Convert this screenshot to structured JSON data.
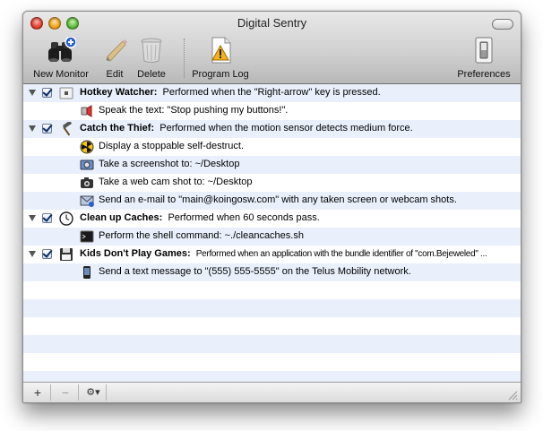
{
  "window": {
    "title": "Digital Sentry"
  },
  "toolbar": {
    "new_monitor": "New Monitor",
    "edit": "Edit",
    "delete": "Delete",
    "program_log": "Program Log",
    "preferences": "Preferences"
  },
  "rows": [
    {
      "kind": "monitor",
      "title": "Hotkey Watcher:",
      "desc": "Performed when the \"Right-arrow\" key is pressed.",
      "icon": "keyboard-icon",
      "checked": true
    },
    {
      "kind": "action",
      "text": "Speak the text: \"Stop pushing my buttons!\".",
      "icon": "speech-icon"
    },
    {
      "kind": "monitor",
      "title": "Catch the Thief:",
      "desc": "Performed when the motion sensor detects medium force.",
      "icon": "hammer-icon",
      "checked": true
    },
    {
      "kind": "action",
      "text": "Display a stoppable self-destruct.",
      "icon": "radiation-icon"
    },
    {
      "kind": "action",
      "text": "Take a screenshot to: ~/Desktop",
      "icon": "screenshot-icon"
    },
    {
      "kind": "action",
      "text": "Take a web cam shot to: ~/Desktop",
      "icon": "camera-icon"
    },
    {
      "kind": "action",
      "text": "Send an e-mail to \"main@koingosw.com\" with any taken screen or webcam shots.",
      "icon": "mail-icon"
    },
    {
      "kind": "monitor",
      "title": "Clean up Caches:",
      "desc": "Performed when 60 seconds pass.",
      "icon": "clock-icon",
      "checked": true
    },
    {
      "kind": "action",
      "text": "Perform the shell command: ~./cleancaches.sh",
      "icon": "terminal-icon"
    },
    {
      "kind": "monitor",
      "title": "Kids Don't Play Games:",
      "desc": "Performed when an application with the bundle identifier of \"com.Bejeweled\" ...",
      "icon": "floppy-icon",
      "checked": true
    },
    {
      "kind": "action",
      "text": "Send a text message to \"(555) 555-5555\" on the Telus Mobility network.",
      "icon": "phone-icon"
    }
  ],
  "bottombar": {
    "add": "+",
    "remove": "−",
    "action": "⚙▾"
  }
}
